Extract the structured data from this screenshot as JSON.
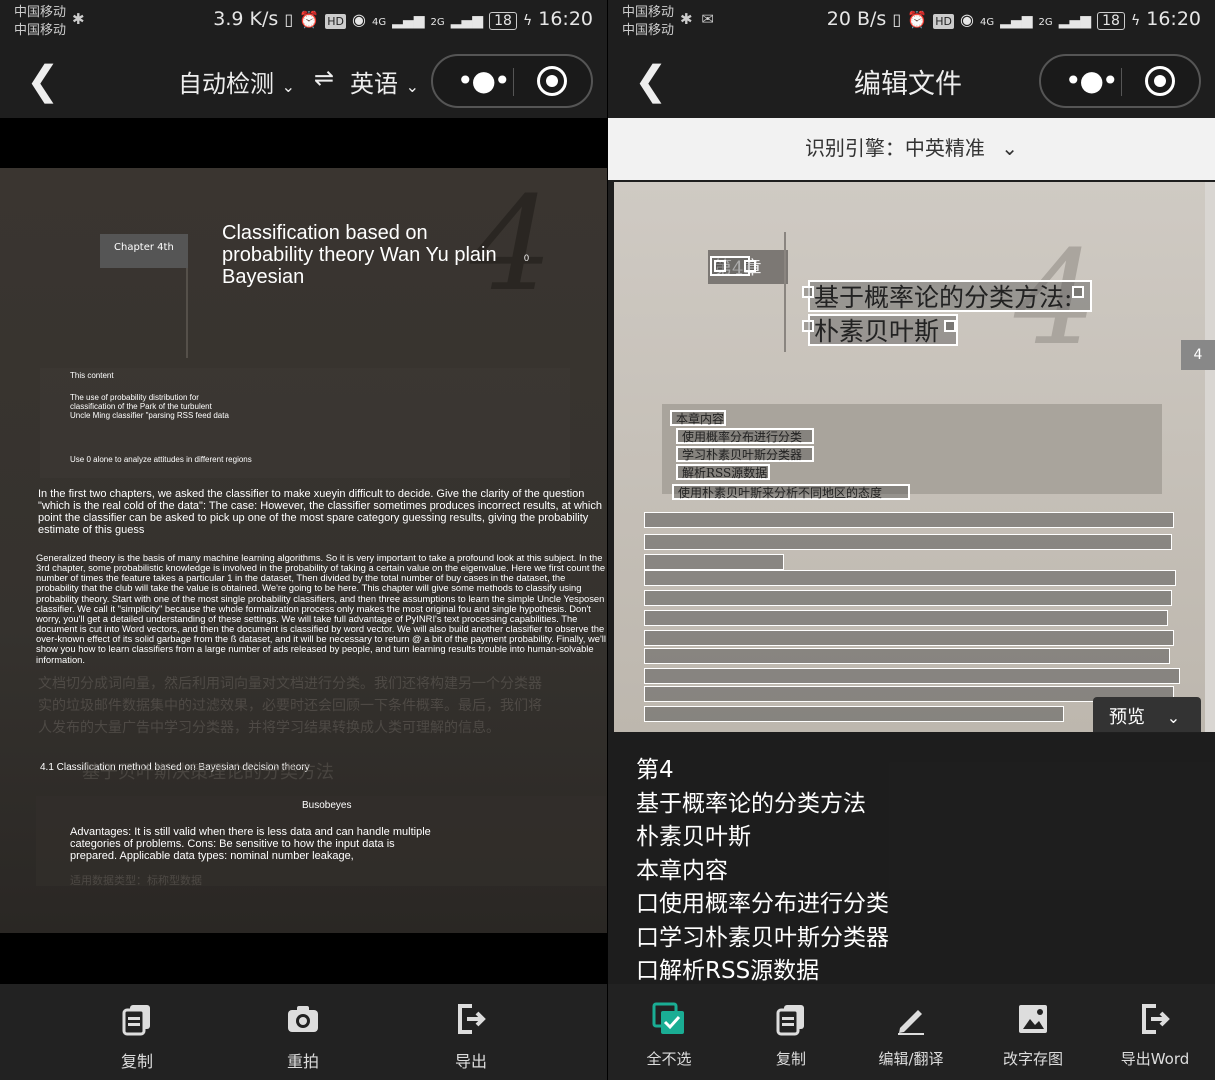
{
  "left": {
    "status": {
      "carrier_1": "中国移动",
      "carrier_2": "中国移动",
      "speed": "3.9 K/s",
      "network_1": "4G",
      "network_2": "2G",
      "battery": "18",
      "time": "16:20"
    },
    "nav": {
      "source_lang": "自动检测",
      "swap_icon": "⇌",
      "target_lang": "英语"
    },
    "overlay": {
      "chapter": "Chapter 4th",
      "big_number": "4",
      "title": "Classification based on probability theory Wan Yu plain Bayesian",
      "page_mark": "0",
      "content_heading": "This content",
      "content_lines": "The use of probability distribution for classification of the Park of the turbulent Uncle Ming classifier \"parsing RSS feed data",
      "content_last": "Use 0 alone to analyze attitudes in different regions",
      "para_1": "In the first two chapters, we asked the classifier to make xueyin difficult to decide. Give the clarity of the question \"which is the real cold of the data\": The case: However, the classifier sometimes produces incorrect results, at which point the classifier can be asked to pick up one of the most spare category guessing results, giving the probability estimate of this guess",
      "para_2": "Generalized theory is the basis of many machine learning algorithms. So it is very important to take a profound look at this subject. In the 3rd chapter, some probabilistic knowledge is involved in the probability of taking a certain value on the eigenvalue. Here we first count the number of times the feature takes a particular 1 in the dataset, Then divided by the total number of buy cases in the dataset, the probability that the club will take the value is obtained. We're going to be here. This chapter will give some methods to classify using probability theory. Start with one of the most single probability classifiers, and then three assumptions to learn the simple Uncle Yesposen classifier. We call it \"simplicity\" because the whole formalization process only makes the most original fou and single hypothesis. Don't worry, you'll get a detailed understanding of these settings. We will take full advantage of PyINRI's text processing capabilities. The document is cut into Word vectors, and then the document is classified by word vector. We will also build another classifier to observe the over-known effect of its solid garbage from the ß dataset, and it will be necessary to return @ a bit of the payment probability. Finally, we'll show you how to learn classifiers from a large number of ads released by people, and turn learning results trouble into human-solvable information.",
      "section": "4.1 Classification method based on Bayesian decision theory",
      "box_title": "Busobeyes",
      "box_text": "Advantages: It is still valid when there is less data and can handle multiple categories of problems. Cons: Be sensitive to how the input data is prepared. Applicable data types: nominal number leakage,"
    },
    "toolbar": {
      "copy": "复制",
      "retake": "重拍",
      "export": "导出"
    }
  },
  "right": {
    "status": {
      "carrier_1": "中国移动",
      "carrier_2": "中国移动",
      "speed": "20 B/s",
      "network_1": "4G",
      "network_2": "2G",
      "battery": "18",
      "time": "16:20"
    },
    "nav": {
      "title": "编辑文件"
    },
    "engine": {
      "label": "识别引擎：中英精准"
    },
    "photo_text": {
      "chapter": "第4章",
      "big_number": "4",
      "side_tab": "4",
      "title_1": "基于概率论的分类方法:",
      "title_2": "朴素贝叶斯",
      "content_head": "本章内容",
      "item_1": "使用概率分布进行分类",
      "item_2": "学习朴素贝叶斯分类器",
      "item_3": "解析RSS源数据",
      "item_4": "使用朴素贝叶斯来分析不同地区的态度"
    },
    "preview": {
      "tab": "预览",
      "lines": [
        "第4",
        "基于概率论的分类方法",
        "朴素贝叶斯",
        "本章内容",
        "口使用概率分布进行分类",
        "口学习朴素贝叶斯分类器",
        "口解析RSS源数据"
      ]
    },
    "toolbar": {
      "deselect_all": "全不选",
      "copy": "复制",
      "edit_translate": "编辑/翻译",
      "save_image": "改字存图",
      "export_word": "导出Word"
    },
    "colors": {
      "accent": "#1aad94"
    }
  }
}
